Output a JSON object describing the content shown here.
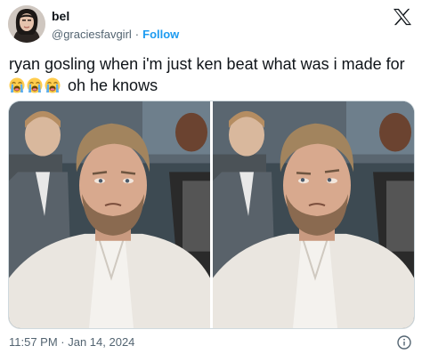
{
  "user": {
    "display_name": "bel",
    "handle": "@graciesfavgirl",
    "separator": "·",
    "follow_label": "Follow"
  },
  "tweet": {
    "text_line1": "ryan gosling when i'm just ken beat what was i made for",
    "emojis": [
      "loudly-crying-face",
      "loudly-crying-face",
      "loudly-crying-face"
    ],
    "text_line2": "oh he knows"
  },
  "footer": {
    "timestamp": "11:57 PM · Jan 14, 2024"
  },
  "icons": {
    "logo": "x-logo-icon",
    "info": "info-icon"
  },
  "colors": {
    "link": "#1d9bf0",
    "secondary_text": "#536471",
    "primary_text": "#0f1419"
  }
}
